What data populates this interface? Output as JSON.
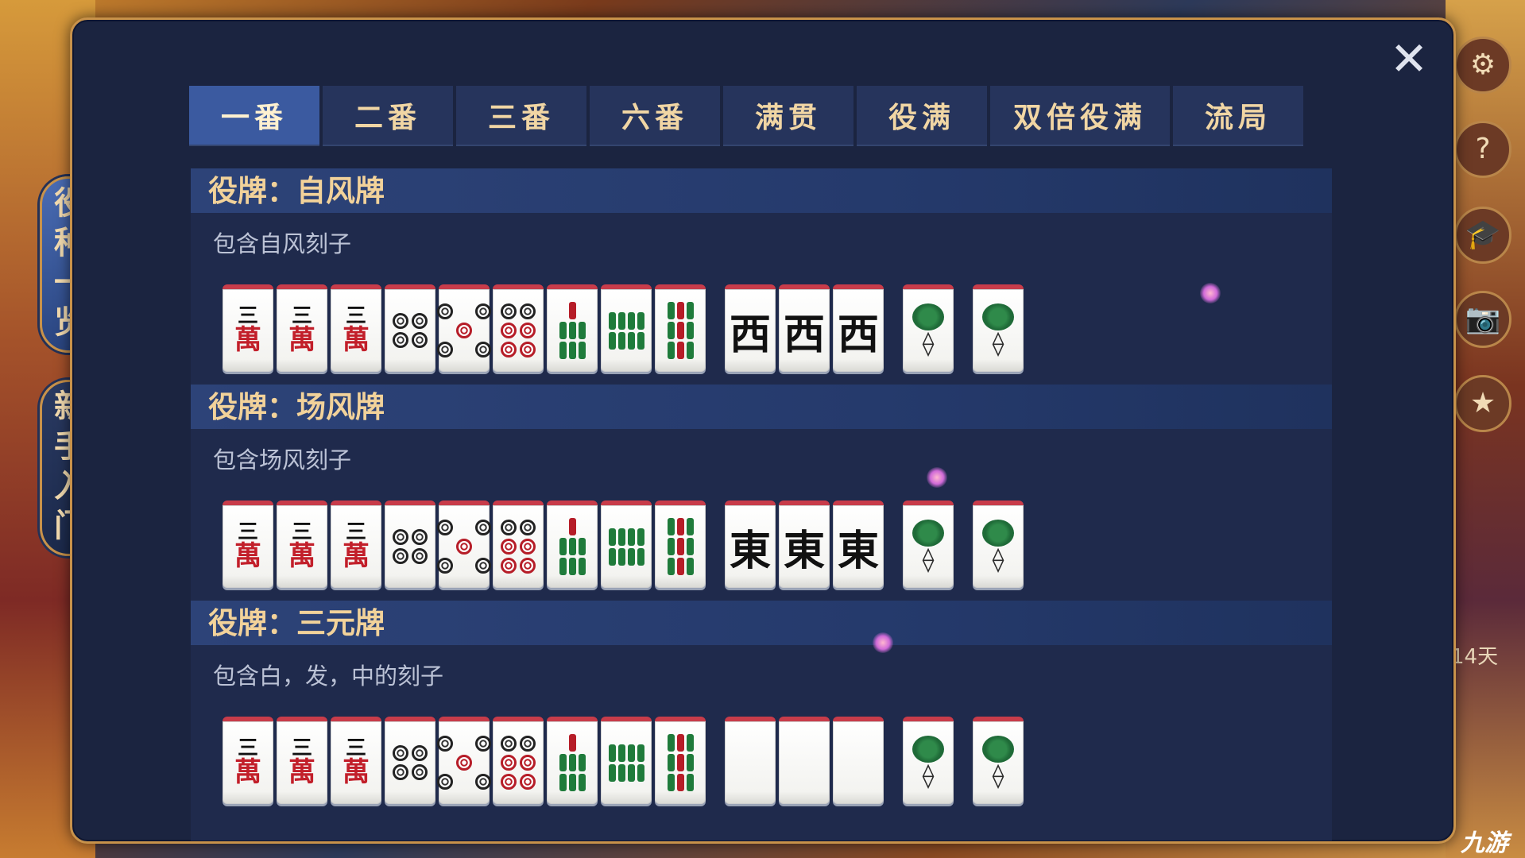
{
  "close_label": "✕",
  "side_tabs": [
    {
      "label": "役种一览",
      "chars": [
        "役",
        "种",
        "一",
        "览"
      ]
    },
    {
      "label": "新手入门",
      "chars": [
        "新",
        "手",
        "入",
        "门"
      ]
    }
  ],
  "right_icons": [
    "gear-icon",
    "help-icon",
    "graduation-cap-icon",
    "camera-icon",
    "badge-icon"
  ],
  "right_icon_glyphs": [
    "⚙",
    "?",
    "🎓",
    "📷",
    "★"
  ],
  "right_side_text": "14天",
  "tabs": [
    "一番",
    "二番",
    "三番",
    "六番",
    "满贯",
    "役满",
    "双倍役满",
    "流局"
  ],
  "active_tab": "一番",
  "sections": [
    {
      "title": "役牌：自风牌",
      "desc": "包含自风刻子",
      "honor": "西"
    },
    {
      "title": "役牌：场风牌",
      "desc": "包含场风刻子",
      "honor": "東"
    },
    {
      "title": "役牌：三元牌",
      "desc": "包含白，发，中的刻子",
      "honor": ""
    }
  ],
  "man_tile": {
    "top": "三",
    "bottom": "萬"
  },
  "watermark": "九游"
}
